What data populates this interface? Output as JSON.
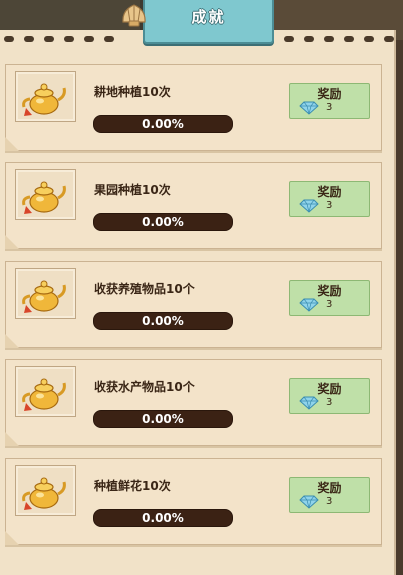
{
  "title": "成就",
  "colors": {
    "tab": "#7fc8cf",
    "panel": "#f1e2c8",
    "progress_bg": "#3b2214",
    "reward_bg": "#bfe0a8"
  },
  "achievements": [
    {
      "name": "耕地种植10次",
      "progress_text": "0.00%",
      "progress": 0,
      "reward_label": "奖励",
      "reward_amount": "3",
      "icon": "golden-teapot-icon"
    },
    {
      "name": "果园种植10次",
      "progress_text": "0.00%",
      "progress": 0,
      "reward_label": "奖励",
      "reward_amount": "3",
      "icon": "golden-teapot-icon"
    },
    {
      "name": "收获养殖物品10个",
      "progress_text": "0.00%",
      "progress": 0,
      "reward_label": "奖励",
      "reward_amount": "3",
      "icon": "golden-teapot-icon"
    },
    {
      "name": "收获水产物品10个",
      "progress_text": "0.00%",
      "progress": 0,
      "reward_label": "奖励",
      "reward_amount": "3",
      "icon": "golden-teapot-icon"
    },
    {
      "name": "种植鲜花10次",
      "progress_text": "0.00%",
      "progress": 0,
      "reward_label": "奖励",
      "reward_amount": "3",
      "icon": "golden-teapot-icon"
    }
  ]
}
